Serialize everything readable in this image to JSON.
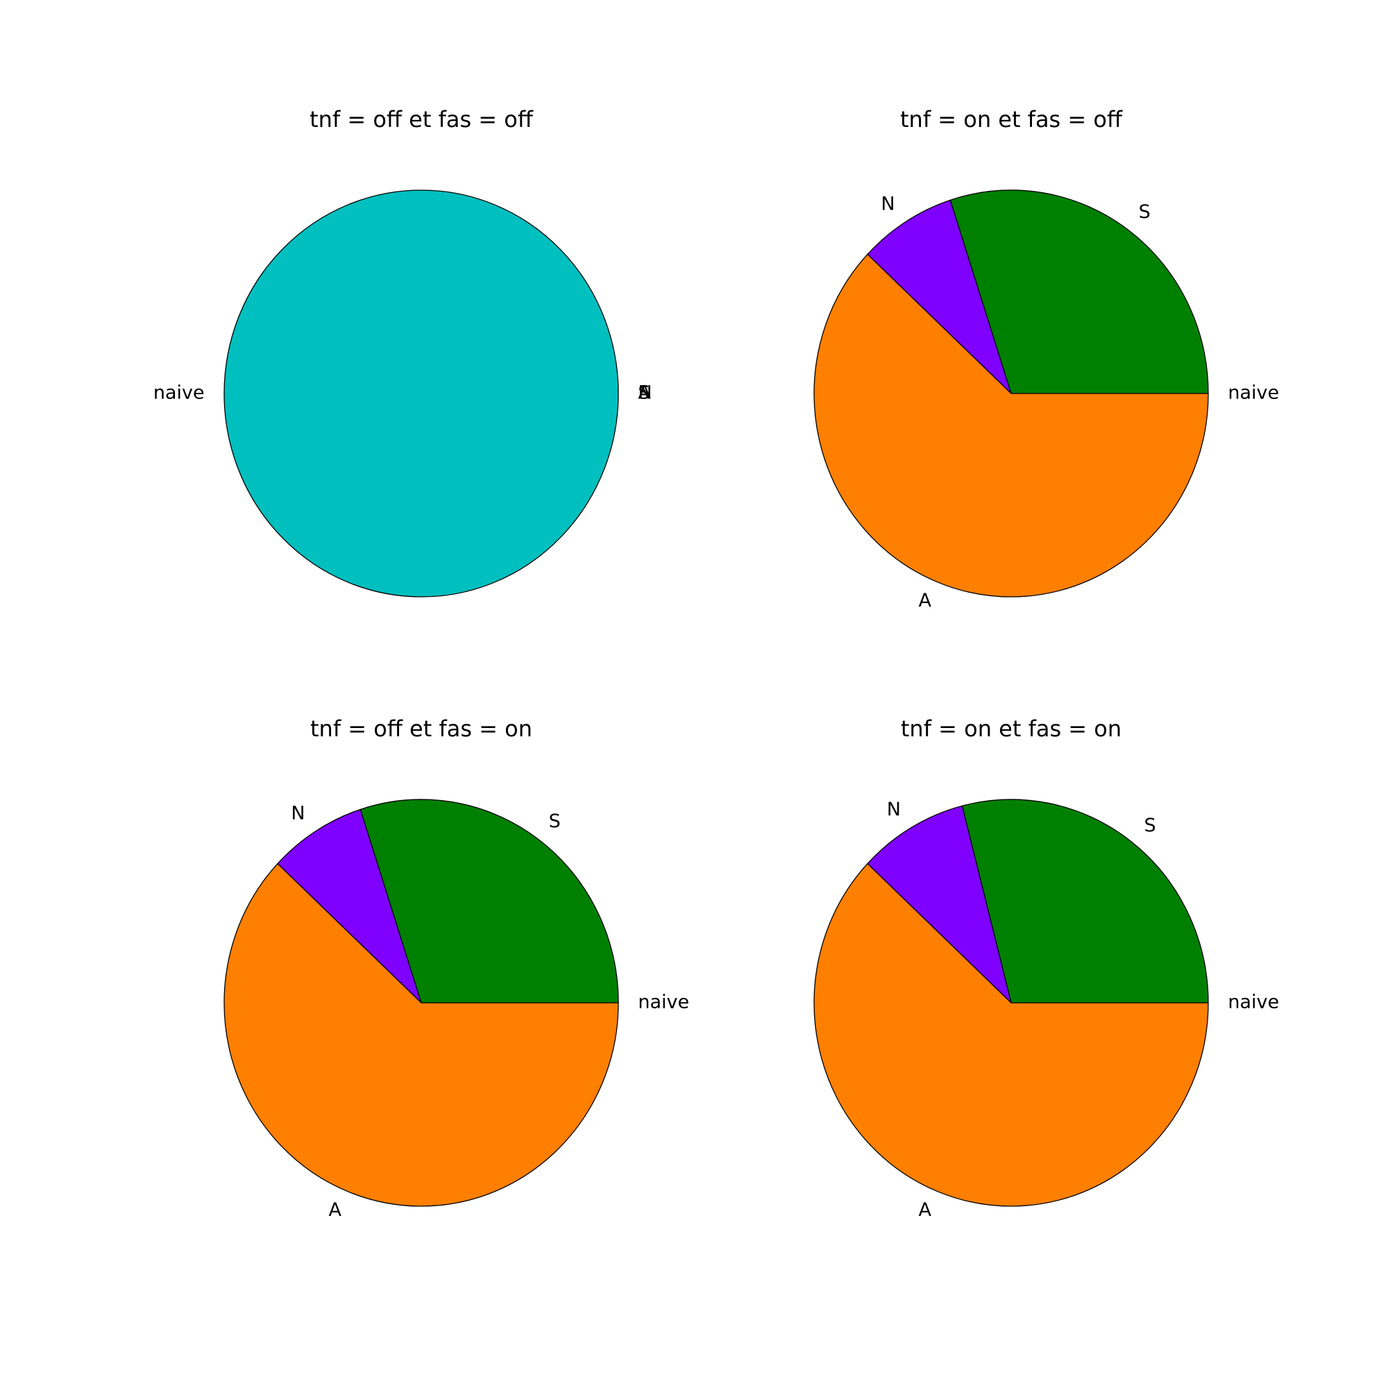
{
  "chart_data": [
    {
      "type": "pie",
      "title": "tnf = off et fas = off",
      "slices": [
        {
          "label": "naive",
          "value": 1.0,
          "color": "#00bfbf"
        },
        {
          "label": "S",
          "value": 0.0,
          "color": "#008000"
        },
        {
          "label": "N",
          "value": 0.0,
          "color": "#7f00ff"
        },
        {
          "label": "A",
          "value": 0.0,
          "color": "#ff7f00"
        }
      ]
    },
    {
      "type": "pie",
      "title": "tnf = on et fas = off",
      "slices": [
        {
          "label": "naive",
          "value": 0.0,
          "color": "#00bfbf"
        },
        {
          "label": "S",
          "value": 0.3,
          "color": "#008000"
        },
        {
          "label": "N",
          "value": 0.08,
          "color": "#7f00ff"
        },
        {
          "label": "A",
          "value": 0.62,
          "color": "#ff7f00"
        }
      ]
    },
    {
      "type": "pie",
      "title": "tnf = off et fas = on",
      "slices": [
        {
          "label": "naive",
          "value": 0.0,
          "color": "#00bfbf"
        },
        {
          "label": "S",
          "value": 0.3,
          "color": "#008000"
        },
        {
          "label": "N",
          "value": 0.08,
          "color": "#7f00ff"
        },
        {
          "label": "A",
          "value": 0.62,
          "color": "#ff7f00"
        }
      ]
    },
    {
      "type": "pie",
      "title": "tnf = on et fas = on",
      "slices": [
        {
          "label": "naive",
          "value": 0.0,
          "color": "#00bfbf"
        },
        {
          "label": "S",
          "value": 0.29,
          "color": "#008000"
        },
        {
          "label": "N",
          "value": 0.09,
          "color": "#7f00ff"
        },
        {
          "label": "A",
          "value": 0.62,
          "color": "#ff7f00"
        }
      ]
    }
  ]
}
